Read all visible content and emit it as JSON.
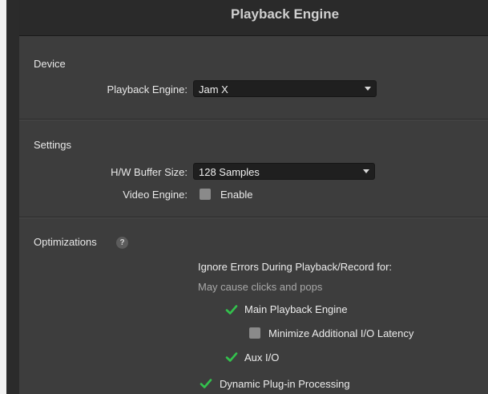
{
  "window": {
    "title": "Playback Engine"
  },
  "device": {
    "section_title": "Device",
    "playback_engine_label": "Playback Engine:",
    "playback_engine_value": "Jam X"
  },
  "settings": {
    "section_title": "Settings",
    "buffer_label": "H/W Buffer Size:",
    "buffer_value": "128 Samples",
    "video_engine_label": "Video Engine:",
    "video_engine_option": "Enable",
    "video_engine_checked": false
  },
  "optimizations": {
    "section_title": "Optimizations",
    "help_glyph": "?",
    "ignore_errors_heading": "Ignore Errors During Playback/Record for:",
    "ignore_errors_note": "May cause clicks and pops",
    "options": [
      {
        "label": "Main Playback Engine",
        "checked": true
      },
      {
        "label": "Minimize Additional I/O Latency",
        "checked": false
      },
      {
        "label": "Aux I/O",
        "checked": true
      },
      {
        "label": "Dynamic Plug-in Processing",
        "checked": true
      }
    ]
  },
  "colors": {
    "check_green": "#33c24d",
    "background": "#3d3d3d",
    "titlebar": "#2a2a2a"
  }
}
